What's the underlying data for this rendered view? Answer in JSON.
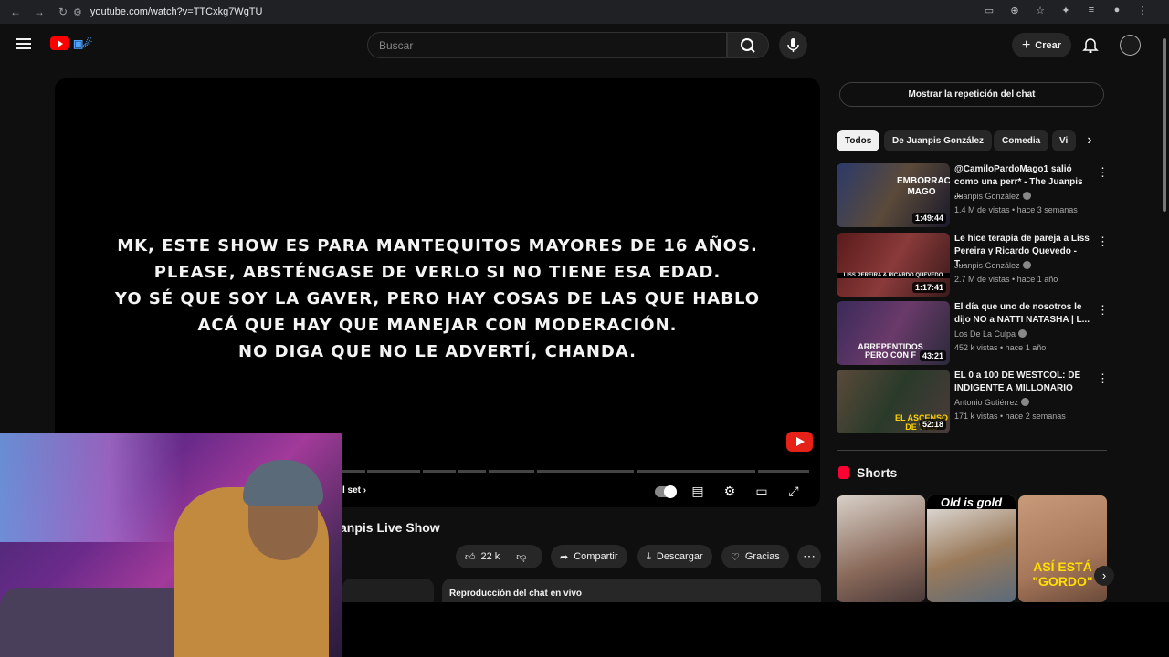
{
  "browser": {
    "url": "youtube.com/watch?v=TTCxkg7WgTU"
  },
  "header": {
    "search_placeholder": "Buscar",
    "create_label": "Crear"
  },
  "player": {
    "overlay_lines": [
      "MK, ESTE SHOW ES PARA MANTEQUITOS MAYORES DE 16 AÑOS.",
      "PLEASE, ABSTÉNGASE DE VERLO SI NO TIENE ESA EDAD.",
      "YO SÉ QUE SOY LA GAVER, PERO HAY COSAS DE LAS QUE HABLO",
      "ACÁ QUE HAY QUE MANEJAR CON MODERACIÓN.",
      "NO DIGA QUE NO LE ADVERTÍ, CHANDA."
    ],
    "chapter_label": "l set"
  },
  "video": {
    "title": "anpis Live Show",
    "likes": "22 k",
    "share_label": "Compartir",
    "download_label": "Descargar",
    "thanks_label": "Gracias",
    "chat_replay_label": "Reproducción del chat en vivo"
  },
  "sidebar": {
    "chat_button": "Mostrar la repetición del chat",
    "chips": [
      "Todos",
      "De Juanpis González",
      "Comedia",
      "Vi"
    ],
    "recommendations": [
      {
        "title": "@CamiloPardoMago1 salió como una perr* - The Juanpis ...",
        "channel": "Juanpis González",
        "meta": "1.4 M de vistas • hace 3 semanas",
        "duration": "1:49:44",
        "thumb_text": "EMBORRACHÉ MAGO"
      },
      {
        "title": "Le hice terapia de pareja a Liss Pereira y Ricardo Quevedo - T...",
        "channel": "Juanpis González",
        "meta": "2.7 M de vistas • hace 1 año",
        "duration": "1:17:41",
        "thumb_text": "LISS PEREIRA & RICARDO QUEVEDO"
      },
      {
        "title": "El día que uno de nosotros le dijo NO a NATTI NATASHA | L...",
        "channel": "Los De La Culpa",
        "meta": "452 k vistas • hace 1 año",
        "duration": "43:21",
        "thumb_text": "ARREPENTIDOS PERO CON F"
      },
      {
        "title": "EL 0 a 100 DE WESTCOL: DE INDIGENTE A MILLONARIO",
        "channel": "Antonio Gutiérrez",
        "meta": "171 k vistas • hace 2 semanas",
        "duration": "52:18",
        "thumb_text": "EL ASCENSO DE WES"
      }
    ],
    "shorts_title": "Shorts",
    "shorts": [
      {
        "text": ""
      },
      {
        "text": "Old is gold"
      },
      {
        "text": "ASÍ ESTÁ \"GORDO\""
      }
    ]
  },
  "colors": {
    "background": "#0f0f0f",
    "brand_red": "#ff0000",
    "chip_active": "#f1f1f1"
  }
}
